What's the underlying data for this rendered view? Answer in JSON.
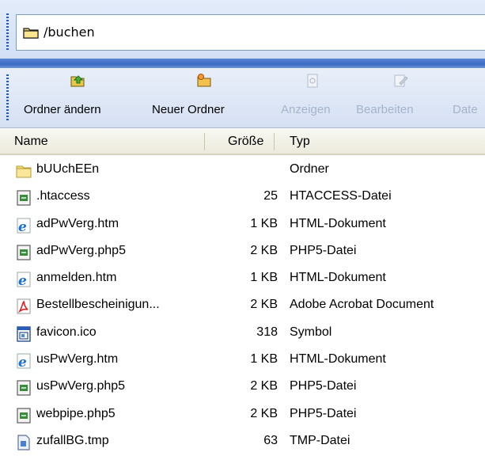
{
  "address": {
    "path": "/buchen"
  },
  "toolbar": {
    "buttons": [
      {
        "label": "Ordner ändern",
        "icon": "change-folder-icon",
        "enabled": true
      },
      {
        "label": "Neuer Ordner",
        "icon": "new-folder-icon",
        "enabled": true
      },
      {
        "label": "Anzeigen",
        "icon": "view-icon",
        "enabled": false
      },
      {
        "label": "Bearbeiten",
        "icon": "edit-icon",
        "enabled": false
      },
      {
        "label": "Date",
        "icon": "file-icon",
        "enabled": false
      }
    ]
  },
  "columns": {
    "name": "Name",
    "size": "Größe",
    "type": "Typ"
  },
  "files": [
    {
      "name": "bUUchEEn",
      "size": "",
      "type": "Ordner",
      "icon": "folder-icon"
    },
    {
      "name": ".htaccess",
      "size": "25",
      "type": "HTACCESS-Datei",
      "icon": "script-file-icon"
    },
    {
      "name": "adPwVerg.htm",
      "size": "1 KB",
      "type": "HTML-Dokument",
      "icon": "ie-html-icon"
    },
    {
      "name": "adPwVerg.php5",
      "size": "2 KB",
      "type": "PHP5-Datei",
      "icon": "script-file-icon"
    },
    {
      "name": "anmelden.htm",
      "size": "1 KB",
      "type": "HTML-Dokument",
      "icon": "ie-html-icon"
    },
    {
      "name": "Bestellbescheinigun...",
      "size": "2 KB",
      "type": "Adobe Acrobat Document",
      "icon": "pdf-icon"
    },
    {
      "name": "favicon.ico",
      "size": "318",
      "type": "Symbol",
      "icon": "ico-file-icon"
    },
    {
      "name": "usPwVerg.htm",
      "size": "1 KB",
      "type": "HTML-Dokument",
      "icon": "ie-html-icon"
    },
    {
      "name": "usPwVerg.php5",
      "size": "2 KB",
      "type": "PHP5-Datei",
      "icon": "script-file-icon"
    },
    {
      "name": "webpipe.php5",
      "size": "2 KB",
      "type": "PHP5-Datei",
      "icon": "script-file-icon"
    },
    {
      "name": "zufallBG.tmp",
      "size": "63",
      "type": "TMP-Datei",
      "icon": "tmp-file-icon"
    }
  ]
}
